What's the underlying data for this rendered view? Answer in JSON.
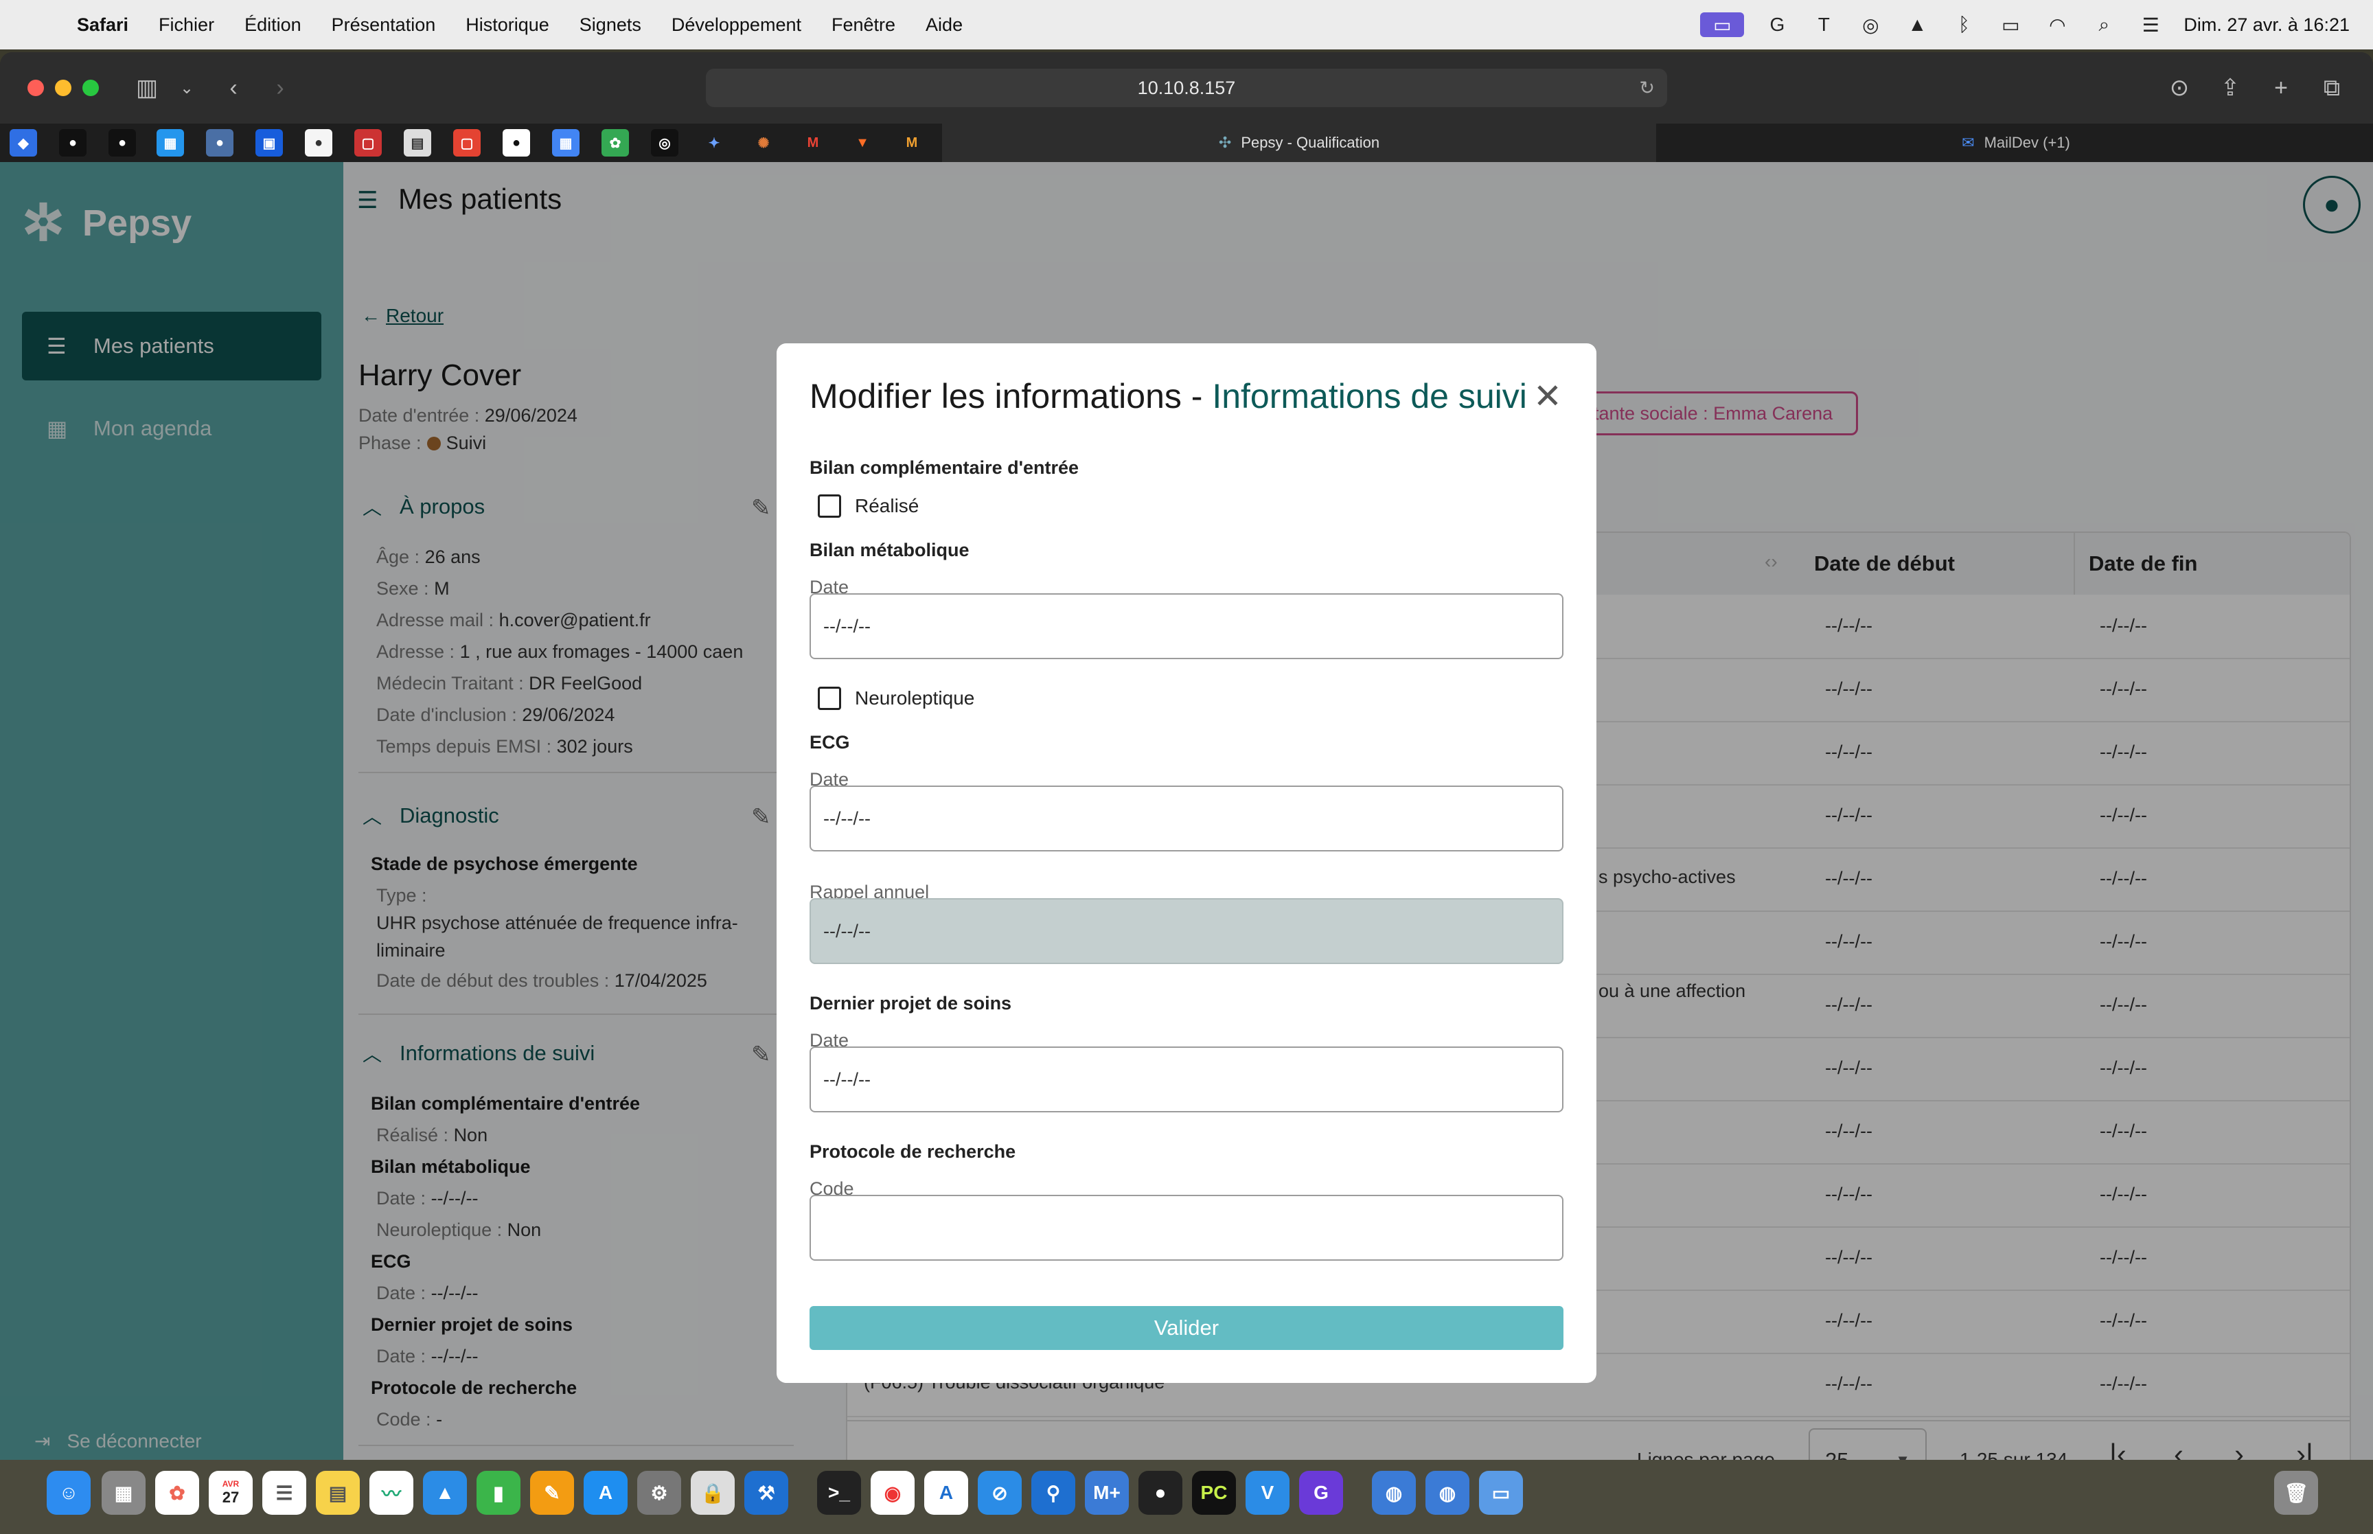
{
  "menubar": {
    "apple_icon": "apple-icon",
    "app_name": "Safari",
    "menus": [
      "Fichier",
      "Édition",
      "Présentation",
      "Historique",
      "Signets",
      "Développement",
      "Fenêtre",
      "Aide"
    ],
    "clock": "Dim. 27 avr. à 16:21",
    "tray_icons": [
      "screen-mirroring-icon",
      "grammarly-icon",
      "tt-icon",
      "vpn-icon",
      "notch-icon",
      "bluetooth-icon",
      "battery-icon",
      "wifi-icon",
      "search-icon",
      "control-center-icon"
    ]
  },
  "browser": {
    "url": "10.10.8.157",
    "tabs": [
      {
        "label": "Pepsy - Qualification",
        "active": true
      },
      {
        "label": "MailDev (+1)",
        "active": false
      }
    ],
    "favorites": [
      "jira",
      "github",
      "github2",
      "docker",
      "gitlab-profile",
      "bitwarden",
      "plex",
      "notion",
      "calendar",
      "todoist",
      "apple",
      "google-calendar",
      "google-photos",
      "openai",
      "gemini",
      "claude",
      "gmail",
      "gitlab",
      "gmail2"
    ]
  },
  "app": {
    "logo": "Pepsy",
    "nav": [
      {
        "label": "Mes patients",
        "active": true
      },
      {
        "label": "Mon agenda",
        "active": false
      }
    ],
    "logout": "Se déconnecter",
    "page_title": "Mes patients"
  },
  "patient": {
    "back": "Retour",
    "name": "Harry Cover",
    "entry_label": "Date d'entrée :",
    "entry_value": "29/06/2024",
    "phase_label": "Phase :",
    "phase_value": "Suivi",
    "about": {
      "title": "À propos",
      "rows": [
        {
          "label": "Âge :",
          "value": "26 ans"
        },
        {
          "label": "Sexe :",
          "value": "M"
        },
        {
          "label": "Adresse mail :",
          "value": "h.cover@patient.fr"
        },
        {
          "label": "Adresse :",
          "value": "1 , rue aux fromages - 14000 caen"
        },
        {
          "label": "Médecin Traitant :",
          "value": "DR FeelGood"
        },
        {
          "label": "Date d'inclusion :",
          "value": "29/06/2024"
        },
        {
          "label": "Temps depuis EMSI :",
          "value": "302 jours"
        }
      ]
    },
    "diagnostic": {
      "title": "Diagnostic",
      "stage": "Stade de psychose émergente",
      "type_label": "Type :",
      "type_value": "UHR psychose atténuée de frequence infra-liminaire",
      "start_label": "Date de début des troubles :",
      "start_value": "17/04/2025"
    },
    "followup": {
      "title": "Informations de suivi",
      "bilan_title": "Bilan complémentaire d'entrée",
      "realise_label": "Réalisé :",
      "realise_value": "Non",
      "metabolique_title": "Bilan métabolique",
      "date_label": "Date :",
      "date_value": "--/--/--",
      "neuro_label": "Neuroleptique :",
      "neuro_value": "Non",
      "ecg_title": "ECG",
      "ecg_date_label": "Date :",
      "ecg_date_value": "--/--/--",
      "projet_title": "Dernier projet de soins",
      "projet_date_label": "Date :",
      "projet_date_value": "--/--/--",
      "protocole_title": "Protocole de recherche",
      "code_label": "Code :",
      "code_value": "-"
    }
  },
  "social_pill": "tante sociale : Emma Carena",
  "table": {
    "headers": [
      "Date de début",
      "Date de fin"
    ],
    "rows": [
      {
        "text": "",
        "start": "--/--/--",
        "end": "--/--/--"
      },
      {
        "text": "",
        "start": "--/--/--",
        "end": "--/--/--"
      },
      {
        "text": "",
        "start": "--/--/--",
        "end": "--/--/--"
      },
      {
        "text": "",
        "start": "--/--/--",
        "end": "--/--/--"
      },
      {
        "text": "s psycho-actives",
        "start": "--/--/--",
        "end": "--/--/--"
      },
      {
        "text": "",
        "start": "--/--/--",
        "end": "--/--/--"
      },
      {
        "text": "ou à une affection",
        "start": "--/--/--",
        "end": "--/--/--"
      },
      {
        "text": "",
        "start": "--/--/--",
        "end": "--/--/--"
      },
      {
        "text": "",
        "start": "--/--/--",
        "end": "--/--/--"
      },
      {
        "text": "",
        "start": "--/--/--",
        "end": "--/--/--"
      },
      {
        "text": "",
        "start": "--/--/--",
        "end": "--/--/--"
      },
      {
        "text": "",
        "start": "--/--/--",
        "end": "--/--/--"
      },
      {
        "text": "(F06.5) Trouble dissociatif organique",
        "start": "--/--/--",
        "end": "--/--/--"
      }
    ],
    "rows_per_page_label": "Lignes par page",
    "rows_per_page": "25",
    "range": "1-25 sur 134"
  },
  "modal": {
    "title_prefix": "Modifier les informations -",
    "title_accent": "Informations de suivi",
    "bilan_title": "Bilan complémentaire d'entrée",
    "realise": "Réalisé",
    "metabolique_title": "Bilan métabolique",
    "date_label": "Date",
    "date_placeholder": "--/--/--",
    "neuroleptique": "Neuroleptique",
    "ecg_title": "ECG",
    "ecg_date_label": "Date",
    "ecg_placeholder": "--/--/--",
    "rappel_label": "Rappel annuel",
    "rappel_placeholder": "--/--/--",
    "projet_title": "Dernier projet de soins",
    "projet_date_label": "Date",
    "projet_placeholder": "--/--/--",
    "protocole_title": "Protocole de recherche",
    "code_label": "Code",
    "code_value": "",
    "validate": "Valider"
  },
  "dock": {
    "calendar_day": "27",
    "calendar_month": "AVR"
  }
}
